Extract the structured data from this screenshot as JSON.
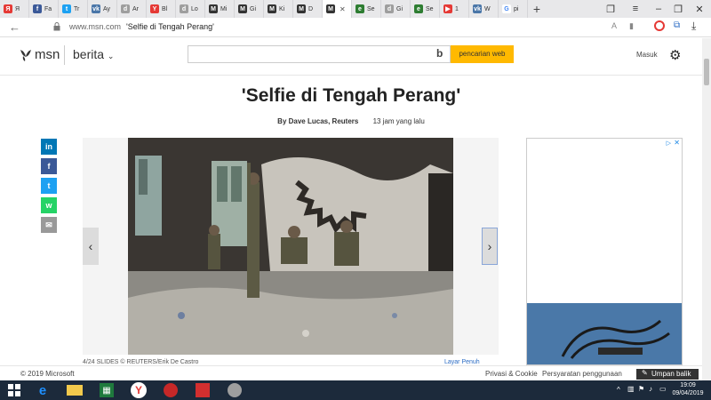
{
  "browser": {
    "tabs": [
      {
        "icon": "Я",
        "color": "#e53935",
        "label": "Я"
      },
      {
        "icon": "f",
        "color": "#3b5998",
        "label": "Fa"
      },
      {
        "icon": "t",
        "color": "#1da1f2",
        "label": "Tr"
      },
      {
        "icon": "vk",
        "color": "#4a76a8",
        "label": "Ay"
      },
      {
        "icon": "d",
        "color": "#9e9e9e",
        "label": "Ar"
      },
      {
        "icon": "Y",
        "color": "#e53935",
        "label": "Bl"
      },
      {
        "icon": "d",
        "color": "#9e9e9e",
        "label": "Lo"
      },
      {
        "icon": "M",
        "color": "#333333",
        "label": "Mi"
      },
      {
        "icon": "M",
        "color": "#333333",
        "label": "Gi"
      },
      {
        "icon": "M",
        "color": "#333333",
        "label": "Ki"
      },
      {
        "icon": "M",
        "color": "#333333",
        "label": "D"
      },
      {
        "icon": "M",
        "color": "#333333",
        "label": "",
        "active": true
      },
      {
        "icon": "e",
        "color": "#2e7d32",
        "label": "Se"
      },
      {
        "icon": "d",
        "color": "#9e9e9e",
        "label": "Gi"
      },
      {
        "icon": "e",
        "color": "#2e7d32",
        "label": "Se"
      },
      {
        "icon": "▶",
        "color": "#e53935",
        "label": "1"
      },
      {
        "icon": "vk",
        "color": "#4a76a8",
        "label": "W"
      },
      {
        "icon": "G",
        "color": "#ffffff",
        "label": "pi"
      }
    ],
    "new_tab": "+",
    "domain": "www.msn.com",
    "page_title": "'Selfie di Tengah Perang'"
  },
  "msn": {
    "logo_text": "msn",
    "section": "berita",
    "search_placeholder": "",
    "search_button": "pencarian web",
    "signin": "Masuk"
  },
  "article": {
    "headline": "'Selfie di Tengah Perang'",
    "author": "By Dave Lucas, Reuters",
    "time": "13 jam yang lalu",
    "share": [
      {
        "name": "linkedin",
        "icon": "in",
        "color": "#0077b5"
      },
      {
        "name": "facebook",
        "icon": "f",
        "color": "#3b5998"
      },
      {
        "name": "twitter",
        "icon": "t",
        "color": "#1da1f2"
      },
      {
        "name": "whatsapp",
        "icon": "w",
        "color": "#25d366"
      },
      {
        "name": "email",
        "icon": "✉",
        "color": "#999999"
      }
    ],
    "caption": "4/24 SLIDES © REUTERS/Erik De Castro",
    "fullscreen": "Layar Penuh"
  },
  "footer": {
    "copyright": "© 2019 Microsoft",
    "privacy": "Privasi & Cookie",
    "terms": "Persyaratan penggunaan",
    "feedback": "Umpan balik"
  },
  "taskbar": {
    "time": "19:09",
    "date": "09/04/2019"
  }
}
